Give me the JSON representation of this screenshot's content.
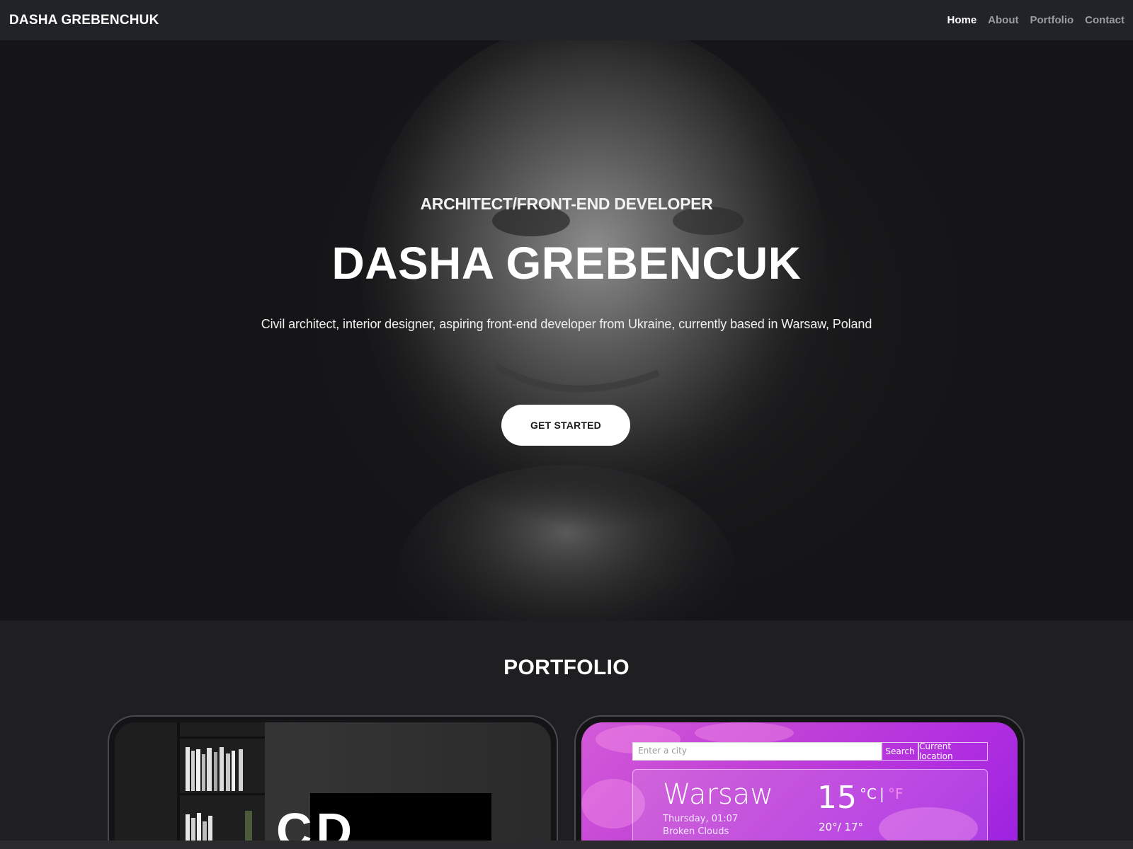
{
  "navbar": {
    "brand": "DASHA GREBENCHUK",
    "links": [
      {
        "label": "Home",
        "active": true
      },
      {
        "label": "About",
        "active": false
      },
      {
        "label": "Portfolio",
        "active": false
      },
      {
        "label": "Contact",
        "active": false
      }
    ]
  },
  "hero": {
    "subtitle": "ARCHITECT/FRONT-END DEVELOPER",
    "title": "DASHA GREBENCUK",
    "description": "Civil architect, interior designer, aspiring front-end developer from Ukraine, currently based in Warsaw, Poland",
    "cta_label": "GET STARTED"
  },
  "portfolio": {
    "title": "PORTFOLIO",
    "cards": [
      {
        "logo_text": "CD"
      },
      {
        "search_placeholder": "Enter a city",
        "search_button": "Search",
        "location_button": "Current location",
        "city": "Warsaw",
        "date": "Thursday, 01:07",
        "description": "Broken Clouds",
        "temperature": "15",
        "unit_c": "°C",
        "unit_sep": "|",
        "unit_f": "°F",
        "range": "20°/ 17°"
      }
    ]
  },
  "colors": {
    "navbar_bg": "#212329",
    "page_bg": "#1f1f21",
    "accent_weather": "#c243d6"
  }
}
